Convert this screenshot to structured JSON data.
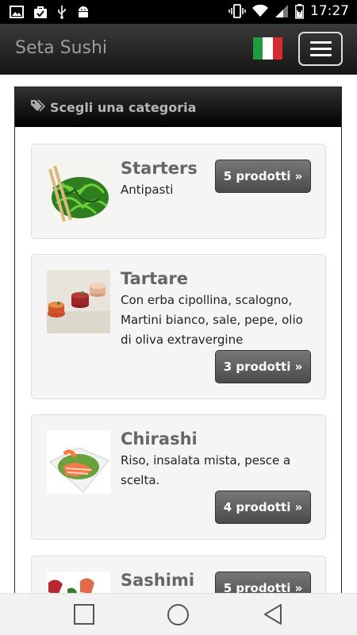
{
  "status_bar": {
    "time": "17:27",
    "left_icons": [
      "image-icon",
      "check-bag-icon",
      "usb-icon",
      "android-icon"
    ],
    "right_icons": [
      "vibrate-icon",
      "wifi-icon",
      "signal-icon",
      "battery-icon"
    ]
  },
  "navbar": {
    "brand": "Seta Sushi",
    "language_flag": "italian-flag-icon",
    "menu_button": "hamburger-menu-icon"
  },
  "panel": {
    "title": "Scegli una categoria",
    "icon": "tags-icon"
  },
  "categories": [
    {
      "name": "Starters",
      "description": "Antipasti",
      "button": "5 prodotti »",
      "image": "seaweed-salad-image"
    },
    {
      "name": "Tartare",
      "description": "Con erba cipollina, scalogno, Martini bianco, sale, pepe, olio di oliva extravergine",
      "button": "3 prodotti »",
      "image": "tartare-image"
    },
    {
      "name": "Chirashi",
      "description": "Riso, insalata mista, pesce a scelta.",
      "button": "4 prodotti »",
      "image": "chirashi-bowl-image"
    },
    {
      "name": "Sashimi",
      "description": "",
      "button": "5 prodotti »",
      "image": "sashimi-image"
    }
  ],
  "system_nav": [
    "recents-button",
    "home-button",
    "back-button"
  ],
  "colors": {
    "navbar": "#1f1f1f",
    "button": "#555555",
    "card_bg": "#f5f5f5",
    "brand_text": "#9c9c9c"
  }
}
